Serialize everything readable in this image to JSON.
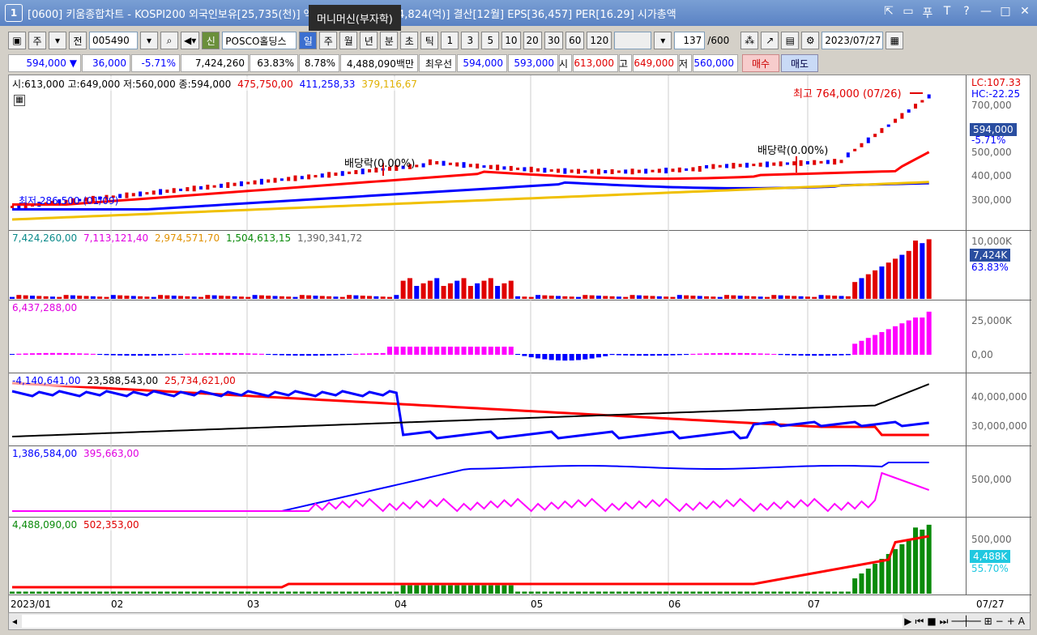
{
  "window": {
    "number": "1",
    "title": "[0600] 키움종합차트 - KOSPI200 외국인보유[25,735(천)] 액면[5,000] 자본금[4,824(억)] 결산[12월] EPS[36,457] PER[16.29] 시가총액",
    "tooltip": "머니머신(부자학)",
    "controls": [
      "⇱",
      "▭",
      "푸",
      "T",
      "?",
      "—",
      "□",
      "✕"
    ]
  },
  "toolbar": {
    "period_label": "주",
    "prev_label": "전",
    "code": "005490",
    "new_label": "신",
    "stock_name": "POSCO홀딩스",
    "tabs": [
      "일",
      "주",
      "월",
      "년",
      "분",
      "초",
      "틱"
    ],
    "intervals": [
      "1",
      "3",
      "5",
      "10",
      "20",
      "30",
      "60",
      "120"
    ],
    "count": "137",
    "count_max": "/600",
    "date": "2023/07/27"
  },
  "quote": {
    "price": "594,000",
    "arrow": "▼",
    "change": "36,000",
    "change_pct": "-5.71%",
    "volume": "7,424,260",
    "vol_ratio": "63.83%",
    "turnover": "8.78%",
    "amount": "4,488,090백만",
    "priority_label": "최우선",
    "ask": "594,000",
    "bid": "593,000",
    "open_label": "시",
    "open": "613,000",
    "high_label": "고",
    "high": "649,000",
    "low_label": "저",
    "low": "560,000",
    "buy_label": "매수",
    "sell_label": "매도"
  },
  "panes": {
    "price": {
      "legend_ohlc": "시:613,000 고:649,000 저:560,000 종:594,000",
      "ma1": "475,750,00",
      "ma2": "411,258,33",
      "ma3": "379,116,67",
      "lc": "LC:107.33",
      "hc": "HC:-22.25",
      "yticks": [
        "700,000",
        "500,000",
        "400,000",
        "300,000"
      ],
      "current": "594,000",
      "current_pct": "-5.71%",
      "high_note": "최고 764,000 (07/26)",
      "low_note": "최저 286,500 (01/09)",
      "div1": "배당락(0.00%)",
      "div2": "배당락(0.00%)"
    },
    "volume": {
      "l1": "7,424,260,00",
      "l2": "7,113,121,40",
      "l3": "2,974,571,70",
      "l4": "1,504,613,15",
      "l5": "1,390,341,72",
      "ytick": "10,000K",
      "current": "7,424K",
      "pct": "63.83%"
    },
    "osc": {
      "l1": "6,437,288,00",
      "ytick1": "25,000K",
      "ytick2": "0,00"
    },
    "holdings": {
      "l1": "-4,140,641,00",
      "l2": "23,588,543,00",
      "l3": "25,734,621,00",
      "ytick1": "40,000,000",
      "ytick2": "30,000,000"
    },
    "inst": {
      "l1": "1,386,584,00",
      "l2": "395,663,00",
      "ytick": "500,000"
    },
    "amount": {
      "l1": "4,488,090,00",
      "l2": "502,353,00",
      "ytick": "500,000",
      "current": "4,488K",
      "pct": "55.70%"
    }
  },
  "xaxis": [
    "2023/01",
    "02",
    "03",
    "04",
    "05",
    "06",
    "07",
    "07/27"
  ],
  "colors": {
    "up": "#e00000",
    "down": "#0000ff",
    "ma_red": "#ff0000",
    "ma_blue": "#0000ff",
    "ma_yellow": "#f0c000",
    "magenta": "#ff00ff",
    "green": "#0a8a0a"
  }
}
